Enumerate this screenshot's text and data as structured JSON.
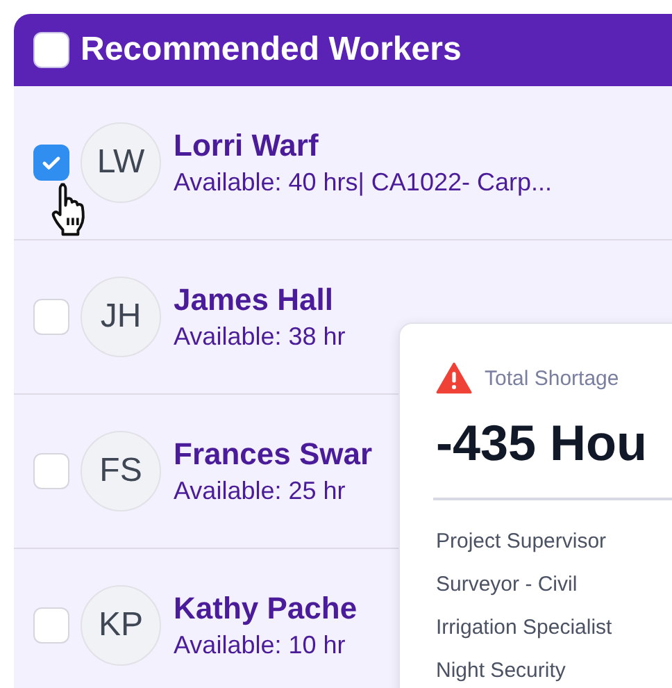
{
  "header": {
    "label": "Recommended Workers",
    "checked": false
  },
  "workers": [
    {
      "initials": "LW",
      "name": "Lorri Warf",
      "availability": "Available: 40 hrs| CA1022- Carp...",
      "selected": true
    },
    {
      "initials": "JH",
      "name": "James Hall",
      "availability": "Available: 38 hr",
      "selected": false
    },
    {
      "initials": "FS",
      "name": "Frances Swar",
      "availability": "Available: 25 hr",
      "selected": false
    },
    {
      "initials": "KP",
      "name": "Kathy Pache",
      "availability": "Available: 10 hr",
      "selected": false
    }
  ],
  "shortage": {
    "label": "Total Shortage",
    "value": "-435 Hou",
    "roles": [
      "Project Supervisor",
      "Surveyor - Civil",
      "Irrigation Specialist",
      "Night Security"
    ]
  }
}
